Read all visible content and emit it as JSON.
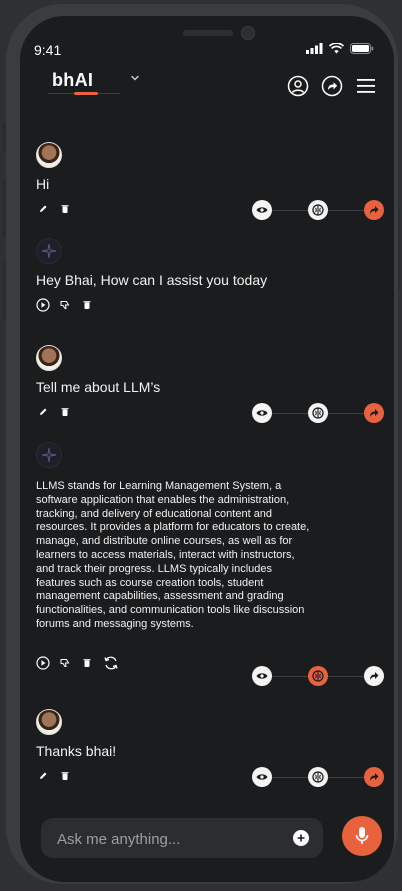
{
  "status": {
    "time": "9:41"
  },
  "header": {
    "brand": "bhAI"
  },
  "messages": [
    {
      "role": "user",
      "text": "Hi"
    },
    {
      "role": "assistant",
      "text": "Hey Bhai, How can I assist you today"
    },
    {
      "role": "user",
      "text": "Tell me about LLM’s"
    },
    {
      "role": "assistant",
      "text": "LLMS stands for Learning Management System, a software application that enables the administration, tracking, and delivery of educational content and resources. It provides a platform for educators to create, manage, and distribute online courses, as well as for learners to access materials, interact with instructors, and track their progress. LLMS typically includes features such as course creation tools, student management capabilities, assessment and grading functionalities, and communication tools like discussion forums and messaging systems."
    },
    {
      "role": "user",
      "text": "Thanks bhai!"
    }
  ],
  "composer": {
    "placeholder": "Ask me anything..."
  },
  "colors": {
    "accent": "#e8623d",
    "background": "#1b1c1e",
    "input": "#2c2d30"
  },
  "icons": [
    "eye-icon",
    "brain-icon",
    "share-icon",
    "profile-icon",
    "menu-icon",
    "mic-icon",
    "plus-icon",
    "edit-icon",
    "delete-icon",
    "play-icon",
    "dislike-icon",
    "regenerate-icon"
  ]
}
